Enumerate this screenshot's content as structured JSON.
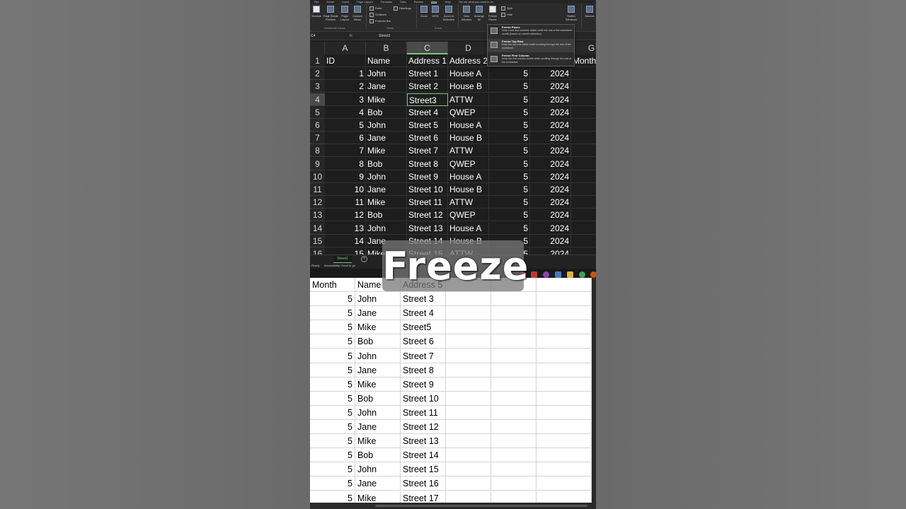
{
  "ribbon": {
    "tabs": [
      "File",
      "Home",
      "Insert",
      "Page Layout",
      "Formulas",
      "Data",
      "Review",
      "View",
      "Help"
    ],
    "active_tab": "View",
    "search_placeholder": "Tell me what you want to do",
    "buttons": {
      "normal": "Normal",
      "page_break_preview": "Page Break Preview",
      "page_layout": "Page Layout",
      "custom_views": "Custom Views",
      "zoom": "Zoom",
      "zoom_100": "100%",
      "zoom_to_selection": "Zoom to Selection",
      "new_window": "New Window",
      "arrange_all": "Arrange All",
      "freeze_panes": "Freeze Panes",
      "split": "Split",
      "hide": "Hide",
      "switch_windows": "Switch Windows",
      "macros": "Macros"
    },
    "show": {
      "ruler": "Ruler",
      "headings": "Headings",
      "gridlines": "Gridlines",
      "formula_bar": "Formula Bar"
    },
    "groups": {
      "workbook_views": "Workbook Views",
      "show": "Show",
      "zoom": "Zoom"
    }
  },
  "formula_bar": {
    "name_box": "C4",
    "fx": "fx",
    "value": "Street3"
  },
  "freeze_menu": {
    "items": [
      {
        "title": "Freeze Panes",
        "desc": "Keep rows and columns visible while the rest of the worksheet scrolls (based on current selection)."
      },
      {
        "title": "Freeze Top Row",
        "desc": "Keep the top row visible while scrolling through the rest of the worksheet."
      },
      {
        "title": "Freeze First Column",
        "desc": "Keep the first column visible while scrolling through the rest of the worksheet."
      }
    ]
  },
  "top_sheet": {
    "columns": [
      "A",
      "B",
      "C",
      "D",
      "",
      "",
      "G"
    ],
    "rows": [
      {
        "n": "1",
        "cells": [
          "ID",
          "Name",
          "Address 1",
          "Address 2",
          "",
          "",
          "Month"
        ]
      },
      {
        "n": "2",
        "cells": [
          "1",
          "John",
          "Street 1",
          "House A",
          "5",
          "2024",
          ""
        ]
      },
      {
        "n": "3",
        "cells": [
          "2",
          "Jane",
          "Street 2",
          "House B",
          "5",
          "2024",
          ""
        ]
      },
      {
        "n": "4",
        "cells": [
          "3",
          "Mike",
          "Street3",
          "ATTW",
          "5",
          "2024",
          ""
        ]
      },
      {
        "n": "5",
        "cells": [
          "4",
          "Bob",
          "Street 4",
          "QWEP",
          "5",
          "2024",
          ""
        ]
      },
      {
        "n": "6",
        "cells": [
          "5",
          "John",
          "Street 5",
          "House A",
          "5",
          "2024",
          ""
        ]
      },
      {
        "n": "7",
        "cells": [
          "6",
          "Jane",
          "Street 6",
          "House B",
          "5",
          "2024",
          ""
        ]
      },
      {
        "n": "8",
        "cells": [
          "7",
          "Mike",
          "Street 7",
          "ATTW",
          "5",
          "2024",
          ""
        ]
      },
      {
        "n": "9",
        "cells": [
          "8",
          "Bob",
          "Street 8",
          "QWEP",
          "5",
          "2024",
          ""
        ]
      },
      {
        "n": "10",
        "cells": [
          "9",
          "John",
          "Street 9",
          "House A",
          "5",
          "2024",
          ""
        ]
      },
      {
        "n": "11",
        "cells": [
          "10",
          "Jane",
          "Street 10",
          "House B",
          "5",
          "2024",
          ""
        ]
      },
      {
        "n": "12",
        "cells": [
          "11",
          "Mike",
          "Street 11",
          "ATTW",
          "5",
          "2024",
          ""
        ]
      },
      {
        "n": "13",
        "cells": [
          "12",
          "Bob",
          "Street 12",
          "QWEP",
          "5",
          "2024",
          ""
        ]
      },
      {
        "n": "14",
        "cells": [
          "13",
          "John",
          "Street 13",
          "House A",
          "5",
          "2024",
          ""
        ]
      },
      {
        "n": "15",
        "cells": [
          "14",
          "Jane",
          "Street 14",
          "House B",
          "5",
          "2024",
          ""
        ]
      },
      {
        "n": "16",
        "cells": [
          "15",
          "Mike",
          "Street 15",
          "ATTW",
          "5",
          "2024",
          ""
        ]
      }
    ]
  },
  "sheet_tabs": [
    "Sheet1"
  ],
  "status": {
    "ready": "Ready",
    "accessibility": "Accessibility: Good to go"
  },
  "bottom_sheet": {
    "rows": [
      [
        "Month",
        "Name",
        "Address 5"
      ],
      [
        "5",
        "John",
        "Street 3"
      ],
      [
        "5",
        "Jane",
        "Street 4"
      ],
      [
        "5",
        "Mike",
        "Street5"
      ],
      [
        "5",
        "Bob",
        "Street 6"
      ],
      [
        "5",
        "John",
        "Street 7"
      ],
      [
        "5",
        "Jane",
        "Street 8"
      ],
      [
        "5",
        "Mike",
        "Street 9"
      ],
      [
        "5",
        "Bob",
        "Street 10"
      ],
      [
        "5",
        "John",
        "Street 11"
      ],
      [
        "5",
        "Jane",
        "Street 12"
      ],
      [
        "5",
        "Mike",
        "Street 13"
      ],
      [
        "5",
        "Bob",
        "Street 14"
      ],
      [
        "5",
        "John",
        "Street 15"
      ],
      [
        "5",
        "Jane",
        "Street 16"
      ],
      [
        "5",
        "Mike",
        "Street 17"
      ]
    ]
  },
  "caption": "Freeze",
  "colors": {
    "accent": "#79c37e",
    "dark_bg": "#1e1e1e",
    "light_bg": "#ffffff"
  }
}
